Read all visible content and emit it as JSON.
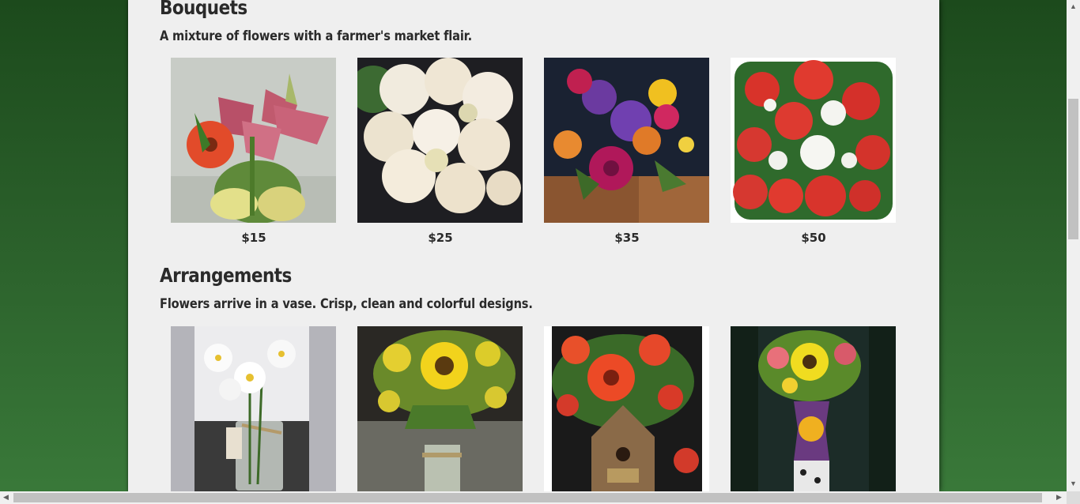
{
  "sections": [
    {
      "title": "Bouquets",
      "description": "A mixture of flowers with a farmer's market flair.",
      "items": [
        {
          "price": "$15",
          "photo": "lily-gerbera-bouquet"
        },
        {
          "price": "$25",
          "photo": "white-rose-bouquet"
        },
        {
          "price": "$35",
          "photo": "peony-mixed-bouquet"
        },
        {
          "price": "$50",
          "photo": "red-rose-bouquet"
        }
      ]
    },
    {
      "title": "Arrangements",
      "description": "Flowers arrive in a vase. Crisp, clean and colorful designs.",
      "items": [
        {
          "photo": "white-daisy-jar"
        },
        {
          "photo": "sunflower-mason-jar"
        },
        {
          "photo": "gerbera-birdhouse"
        },
        {
          "photo": "sunflower-painted-vase"
        }
      ]
    }
  ],
  "colors": {
    "background_green": "#2a5f2a",
    "page_background": "#efefef",
    "text": "#2a2a2a"
  },
  "scrollbar_icons": {
    "up": "scroll-up-arrow-icon",
    "down": "scroll-down-arrow-icon",
    "left": "scroll-left-arrow-icon",
    "right": "scroll-right-arrow-icon"
  }
}
